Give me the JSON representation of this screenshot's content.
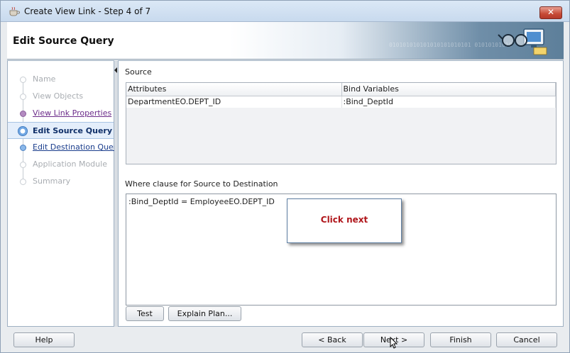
{
  "window": {
    "title": "Create View Link - Step 4 of 7",
    "close_label": "✕"
  },
  "header": {
    "page_title": "Edit Source Query",
    "binary_text": "010101010101010101010101 01010101010"
  },
  "steps": [
    {
      "label": "Name",
      "state": "disabled"
    },
    {
      "label": "View Objects",
      "state": "disabled"
    },
    {
      "label": "View Link Properties",
      "state": "visited"
    },
    {
      "label": "Edit Source Query",
      "state": "current"
    },
    {
      "label": "Edit Destination Query",
      "state": "link"
    },
    {
      "label": "Application Module",
      "state": "disabled"
    },
    {
      "label": "Summary",
      "state": "disabled"
    }
  ],
  "source": {
    "label": "Source",
    "columns": [
      "Attributes",
      "Bind Variables"
    ],
    "rows": [
      [
        "DepartmentEO.DEPT_ID",
        ":Bind_DeptId"
      ]
    ]
  },
  "where": {
    "label": "Where clause for Source to Destination",
    "value": ":Bind_DeptId = EmployeeEO.DEPT_ID"
  },
  "callout": {
    "text": "Click next"
  },
  "buttons": {
    "test": "Test",
    "explain": "Explain Plan...",
    "help": "Help",
    "back": "< Back",
    "next": "Next >",
    "finish": "Finish",
    "cancel": "Cancel"
  },
  "colors": {
    "accent": "#5d9adf",
    "callout_text": "#b0161b",
    "visited_link": "#6c2c8a",
    "link": "#1a3d8c"
  }
}
